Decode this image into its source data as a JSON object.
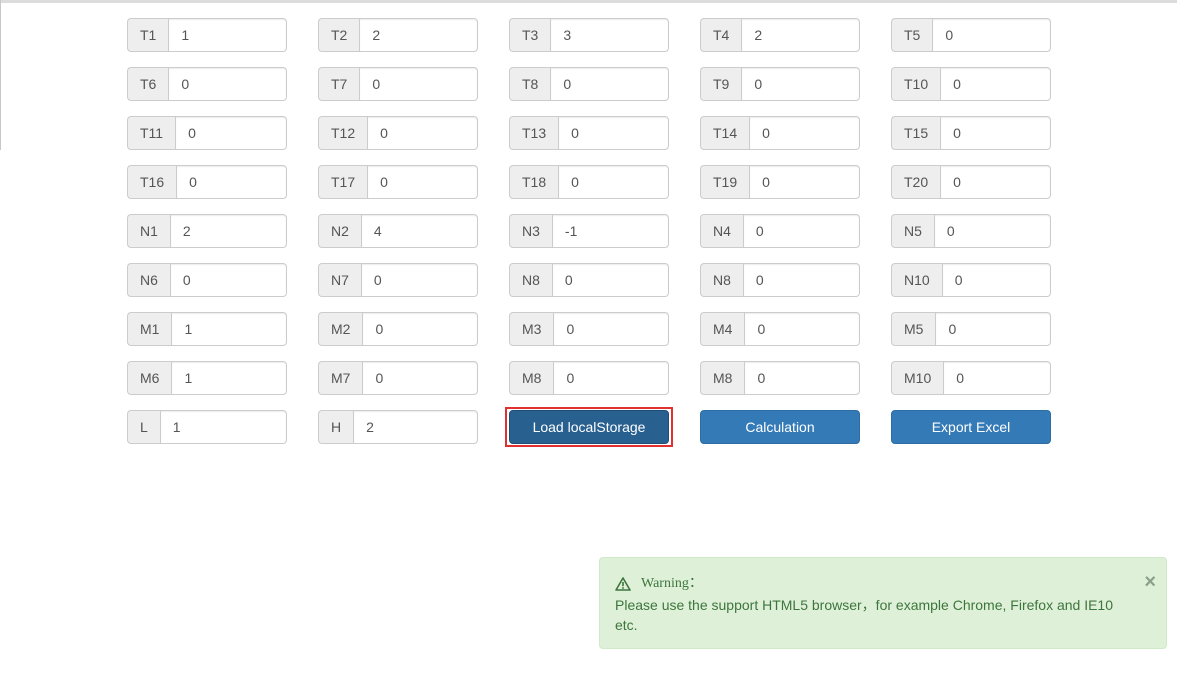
{
  "fields": [
    [
      {
        "label": "T1",
        "value": "1"
      },
      {
        "label": "T2",
        "value": "2"
      },
      {
        "label": "T3",
        "value": "3"
      },
      {
        "label": "T4",
        "value": "2"
      },
      {
        "label": "T5",
        "value": "0"
      }
    ],
    [
      {
        "label": "T6",
        "value": "0"
      },
      {
        "label": "T7",
        "value": "0"
      },
      {
        "label": "T8",
        "value": "0"
      },
      {
        "label": "T9",
        "value": "0"
      },
      {
        "label": "T10",
        "value": "0"
      }
    ],
    [
      {
        "label": "T11",
        "value": "0"
      },
      {
        "label": "T12",
        "value": "0"
      },
      {
        "label": "T13",
        "value": "0"
      },
      {
        "label": "T14",
        "value": "0"
      },
      {
        "label": "T15",
        "value": "0"
      }
    ],
    [
      {
        "label": "T16",
        "value": "0"
      },
      {
        "label": "T17",
        "value": "0"
      },
      {
        "label": "T18",
        "value": "0"
      },
      {
        "label": "T19",
        "value": "0"
      },
      {
        "label": "T20",
        "value": "0"
      }
    ],
    [
      {
        "label": "N1",
        "value": "2"
      },
      {
        "label": "N2",
        "value": "4"
      },
      {
        "label": "N3",
        "value": "-1"
      },
      {
        "label": "N4",
        "value": "0"
      },
      {
        "label": "N5",
        "value": "0"
      }
    ],
    [
      {
        "label": "N6",
        "value": "0"
      },
      {
        "label": "N7",
        "value": "0"
      },
      {
        "label": "N8",
        "value": "0"
      },
      {
        "label": "N8",
        "value": "0"
      },
      {
        "label": "N10",
        "value": "0"
      }
    ],
    [
      {
        "label": "M1",
        "value": "1"
      },
      {
        "label": "M2",
        "value": "0"
      },
      {
        "label": "M3",
        "value": "0"
      },
      {
        "label": "M4",
        "value": "0"
      },
      {
        "label": "M5",
        "value": "0"
      }
    ],
    [
      {
        "label": "M6",
        "value": "1"
      },
      {
        "label": "M7",
        "value": "0"
      },
      {
        "label": "M8",
        "value": "0"
      },
      {
        "label": "M8",
        "value": "0"
      },
      {
        "label": "M10",
        "value": "0"
      }
    ]
  ],
  "bottom_row": {
    "L": {
      "label": "L",
      "value": "1"
    },
    "H": {
      "label": "H",
      "value": "2"
    },
    "load_label": "Load localStorage",
    "calc_label": "Calculation",
    "export_label": "Export Excel"
  },
  "alert": {
    "icon": "warning-triangle-icon",
    "title": "Warning：",
    "message": "Please use the support HTML5 browser，for example Chrome, Firefox and IE10 etc.",
    "close": "×"
  },
  "colors": {
    "primary": "#337ab7",
    "primary_active": "#286090",
    "focus_outline": "#e03030",
    "alert_bg": "#dff0d8",
    "alert_text": "#3c763d"
  }
}
